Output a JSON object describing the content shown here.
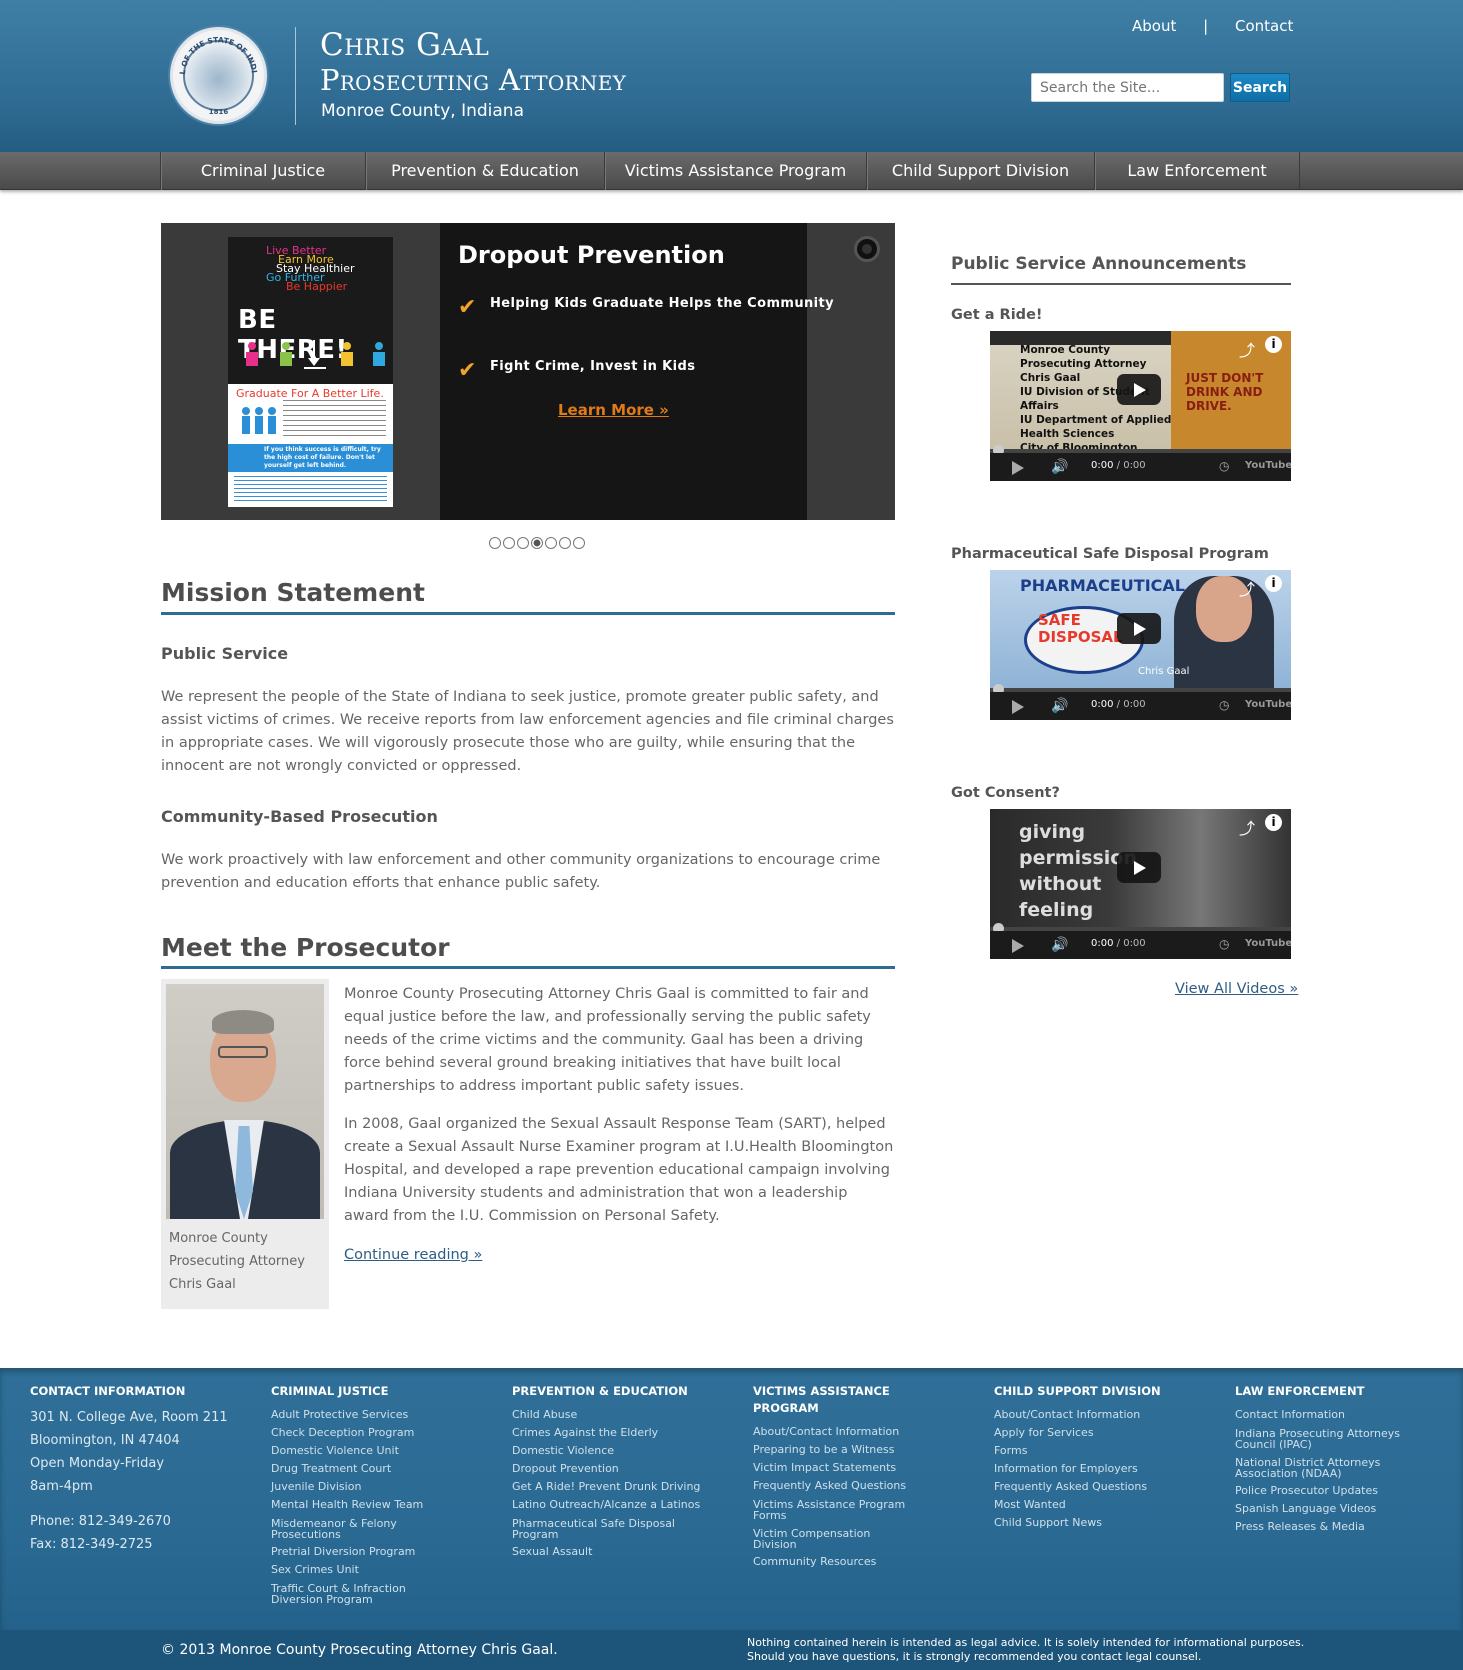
{
  "header": {
    "name": "Chris Gaal",
    "title": "Prosecuting Attorney",
    "subtitle": "Monroe County, Indiana",
    "seal_text": "SEAL OF THE STATE OF INDIANA",
    "seal_year": "1816",
    "links": {
      "about": "About",
      "separator": "|",
      "contact": "Contact"
    },
    "search": {
      "placeholder": "Search the Site...",
      "button": "Search"
    }
  },
  "nav": {
    "items": [
      {
        "label": "Criminal Justice"
      },
      {
        "label": "Prevention & Education"
      },
      {
        "label": "Victims Assistance Program"
      },
      {
        "label": "Child Support Division"
      },
      {
        "label": "Law Enforcement"
      }
    ]
  },
  "slider": {
    "title": "Dropout Prevention",
    "points": [
      "Helping Kids Graduate Helps the Community",
      "Fight Crime, Invest in Kids"
    ],
    "learn_more": "Learn More »",
    "poster": {
      "lines": [
        "Live Better",
        "Earn More",
        "Stay Healthier",
        "Go Further",
        "Be Happier"
      ],
      "headline": "BE THERE!",
      "tagline": "Graduate For A Better Life.",
      "box_text": "If you think success is difficult, try the high cost of failure. Don't let yourself get left behind."
    },
    "dot_count": 7,
    "active_dot": 4
  },
  "mission": {
    "heading": "Mission Statement",
    "public_service_heading": "Public Service",
    "public_service_text": "We represent the people of the State of Indiana to seek justice, promote greater public safety, and assist victims of crimes. We receive reports from law enforcement agencies and file criminal charges in appropriate cases. We will vigorously prosecute those who are guilty, while ensuring that the innocent are not wrongly convicted or oppressed.",
    "community_heading": "Community-Based Prosecution",
    "community_text": "We work proactively with law enforcement and other community organizations to encourage crime prevention and education efforts that enhance public safety."
  },
  "prosecutor": {
    "heading": "Meet the Prosecutor",
    "caption": "Monroe County Prosecuting Attorney Chris Gaal",
    "para1": "Monroe County Prosecuting Attorney Chris Gaal is committed to fair and equal justice before the law, and professionally serving the public safety needs of the crime victims and the community. Gaal has been a driving force behind several ground breaking initiatives that have built local partnerships to address important public safety issues.",
    "para2": "In 2008, Gaal organized the Sexual Assault Response Team (SART), helped create a Sexual Assault Nurse Examiner program at I.U.Health Bloomington Hospital, and developed a rape prevention educational campaign involving Indiana University students and administration that won a leadership award from the I.U. Commission on Personal Safety.",
    "continue": "Continue reading »"
  },
  "sidebar": {
    "heading": "Public Service Announcements",
    "videos": [
      {
        "title": "Get a Ride!",
        "overlay": [
          "Monroe County Prosecuting Attorney Chris Gaal",
          "IU Division of Student Affairs",
          "IU Department of Applied Health Sciences",
          "City of Bloomington"
        ],
        "sign": "JUST DON'T DRINK AND DRIVE.",
        "time_current": "0:00",
        "time_total": "/ 0:00",
        "brand": "YouTube"
      },
      {
        "title": "Pharmaceutical Safe Disposal Program",
        "overlay": [
          "PHARMACEUTICAL",
          "SAFE DISPOSAL",
          "Chris Gaal"
        ],
        "time_current": "0:00",
        "time_total": "/ 0:00",
        "brand": "YouTube"
      },
      {
        "title": "Got Consent?",
        "overlay": [
          "giving",
          "permission",
          "without",
          "feeling"
        ],
        "time_current": "0:00",
        "time_total": "/ 0:00",
        "brand": "YouTube"
      }
    ],
    "view_all": "View All Videos »"
  },
  "footer": {
    "contact": {
      "heading": "Contact Information",
      "address1": "301 N. College Ave, Room 211",
      "address2": "Bloomington, IN 47404",
      "hours": "Open Monday-Friday 8am-4pm",
      "phone": "Phone: 812-349-2670",
      "fax": "Fax: 812-349-2725"
    },
    "columns": [
      {
        "heading": "Criminal Justice",
        "links": [
          "Adult Protective Services",
          "Check Deception Program",
          "Domestic Violence Unit",
          "Drug Treatment Court",
          "Juvenile Division",
          "Mental Health Review Team",
          "Misdemeanor & Felony Prosecutions",
          "Pretrial Diversion Program",
          "Sex Crimes Unit",
          "Traffic Court & Infraction Diversion Program"
        ]
      },
      {
        "heading": "Prevention & Education",
        "links": [
          "Child Abuse",
          "Crimes Against the Elderly",
          "Domestic Violence",
          "Dropout Prevention",
          "Get A Ride! Prevent Drunk Driving",
          "Latino Outreach/Alcanze a Latinos",
          "Pharmaceutical Safe Disposal Program",
          "Sexual Assault"
        ]
      },
      {
        "heading": "Victims Assistance Program",
        "links": [
          "About/Contact Information",
          "Preparing to be a Witness",
          "Victim Impact Statements",
          "Frequently Asked Questions",
          "Victims Assistance Program Forms",
          "Victim Compensation Division",
          "Community Resources"
        ]
      },
      {
        "heading": "Child Support Division",
        "links": [
          "About/Contact Information",
          "Apply for Services",
          "Forms",
          "Information for Employers",
          "Frequently Asked Questions",
          "Most Wanted",
          "Child Support News"
        ]
      },
      {
        "heading": "Law Enforcement",
        "links": [
          "Contact Information",
          "Indiana Prosecuting Attorneys Council (IPAC)",
          "National District Attorneys Association (NDAA)",
          "Police Prosecutor Updates",
          "Spanish Language Videos",
          "Press Releases & Media"
        ]
      }
    ],
    "copyright": "© 2013 Monroe County Prosecuting Attorney Chris Gaal.",
    "disclaimer1": "Nothing contained herein is intended as legal advice. It is solely intended for informational purposes.",
    "disclaimer2": "Should you have questions, it is strongly recommended you contact legal counsel."
  }
}
